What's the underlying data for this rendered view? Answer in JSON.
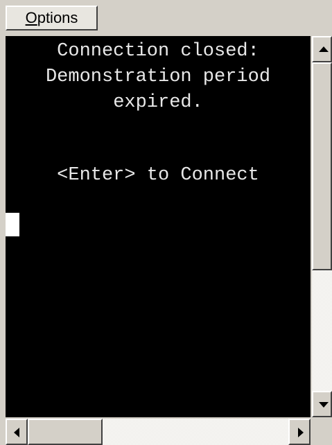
{
  "menu": {
    "options_hotkey": "O",
    "options_rest": "ptions"
  },
  "terminal": {
    "lines": [
      "Connection closed:",
      "Demonstration period",
      "expired.",
      "<Enter> to Connect"
    ],
    "background": "#000000",
    "text_color": "#e8e8e8",
    "cursor_color": "#ffffff"
  },
  "scrollbars": {
    "vertical": {
      "up_icon": "arrow-up-icon",
      "down_icon": "arrow-down-icon"
    },
    "horizontal": {
      "left_icon": "arrow-left-icon",
      "right_icon": "arrow-right-icon"
    }
  }
}
